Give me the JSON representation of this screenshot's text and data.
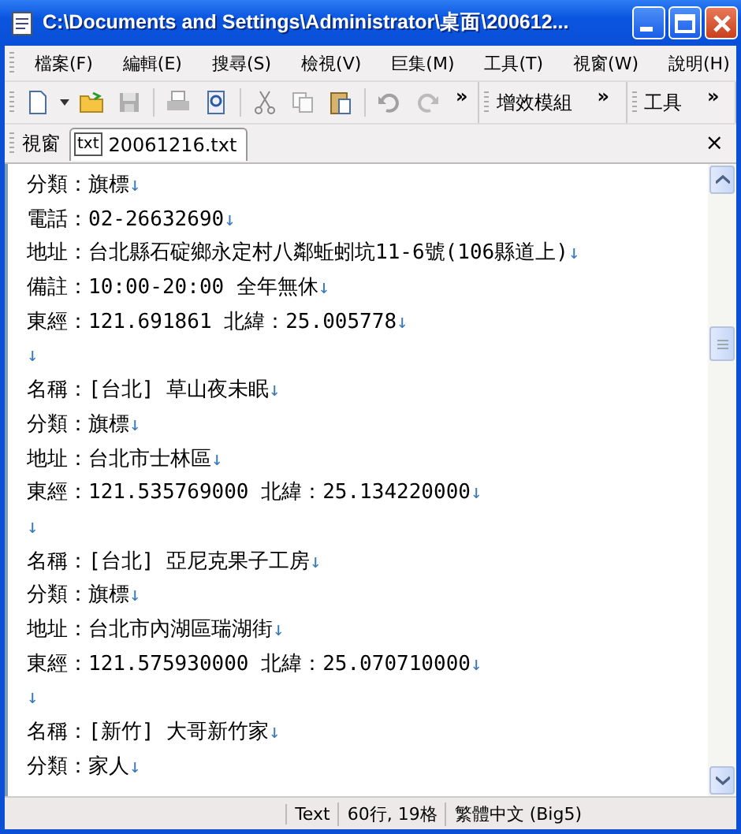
{
  "window": {
    "title": "C:\\Documents and Settings\\Administrator\\桌面\\200612..."
  },
  "menu": [
    "檔案(F)",
    "編輯(E)",
    "搜尋(S)",
    "檢視(V)",
    "巨集(M)",
    "工具(T)",
    "視窗(W)",
    "說明(H)"
  ],
  "toolbar": {
    "chevron": "»",
    "toolbars": [
      {
        "label": "增效模組",
        "chevron": "»"
      },
      {
        "label": "工具",
        "chevron": "»"
      }
    ]
  },
  "tabbar": {
    "label": "視窗",
    "tabs": [
      {
        "icon": "txt",
        "label": "20061216.txt",
        "selected": true
      }
    ],
    "close": "×"
  },
  "lines": [
    {
      "text": "分類：旗標",
      "eol": "↓"
    },
    {
      "text": "電話：02-26632690",
      "eol": "↓"
    },
    {
      "text": "地址：台北縣石碇鄉永定村八鄰蚯蚓坑11-6號(106縣道上)",
      "eol": "↓"
    },
    {
      "text": "備註：10:00-20:00 全年無休",
      "eol": "↓"
    },
    {
      "text": "東經：121.691861 北緯：25.005778",
      "eol": "↓"
    },
    {
      "eol": "↓"
    },
    {
      "text": "名稱：[台北] 草山夜未眠",
      "eol": "↓"
    },
    {
      "text": "分類：旗標",
      "eol": "↓"
    },
    {
      "text": "地址：台北市士林區",
      "eol": "↓"
    },
    {
      "text": "東經：121.535769000 北緯：25.134220000",
      "eol": "↓"
    },
    {
      "eol": "↓"
    },
    {
      "text": "名稱：[台北] 亞尼克果子工房",
      "eol": "↓"
    },
    {
      "text": "分類：旗標",
      "eol": "↓"
    },
    {
      "text": "地址：台北市內湖區瑞湖街",
      "eol": "↓"
    },
    {
      "text": "東經：121.575930000 北緯：25.070710000",
      "eol": "↓"
    },
    {
      "eol": "↓"
    },
    {
      "text": "名稱：[新竹] 大哥新竹家",
      "eol": "↓"
    },
    {
      "text": "分類：家人",
      "eol": "↓"
    }
  ],
  "status_bar": [
    "Text",
    "60行, 19格",
    "繁體中文 (Big5)"
  ]
}
